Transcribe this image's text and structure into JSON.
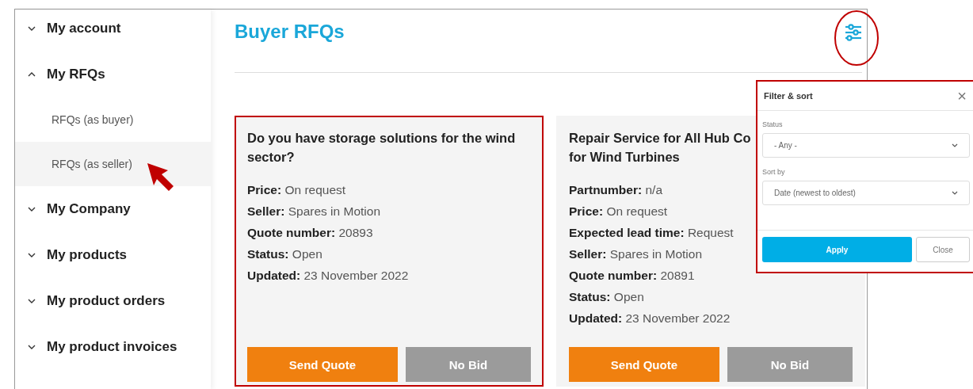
{
  "sidebar": {
    "items": [
      {
        "label": "My account",
        "expanded": false
      },
      {
        "label": "My RFQs",
        "expanded": true,
        "children": [
          {
            "label": "RFQs (as buyer)",
            "selected": false
          },
          {
            "label": "RFQs (as seller)",
            "selected": true
          }
        ]
      },
      {
        "label": "My Company",
        "expanded": false
      },
      {
        "label": "My products",
        "expanded": false
      },
      {
        "label": "My product orders",
        "expanded": false
      },
      {
        "label": "My product invoices",
        "expanded": false
      }
    ]
  },
  "page": {
    "title": "Buyer RFQs"
  },
  "cards": [
    {
      "title_lines": [
        "Do you have storage solutions for the wind",
        "sector?"
      ],
      "highlighted": true,
      "details": [
        "**Price:** On request",
        "**Seller:** Spares in Motion",
        "**Quote number:** 20893",
        "**Status:** Open",
        "**Updated:** 23 November 2022"
      ],
      "buttons": [
        "Send Quote",
        "No Bid"
      ]
    },
    {
      "title_lines": [
        "Repair Service for All Hub Co",
        "for Wind Turbines"
      ],
      "highlighted": false,
      "details": [
        "**Partnumber:** n/a",
        "**Price:** On request",
        "**Expected lead time:** Request",
        "**Seller:** Spares in Motion",
        "**Quote number:** 20891",
        "**Status:** Open",
        "**Updated:** 23 November 2022"
      ],
      "buttons": [
        "Send Quote",
        "No Bid"
      ]
    }
  ],
  "filter_panel": {
    "title": "Filter & sort",
    "close_icon": "×",
    "fields": [
      {
        "label": "Status",
        "value": "- Any -"
      },
      {
        "label": "Sort by",
        "value": "Date (newest to oldest)"
      }
    ],
    "apply": "Apply",
    "close": "Close"
  }
}
